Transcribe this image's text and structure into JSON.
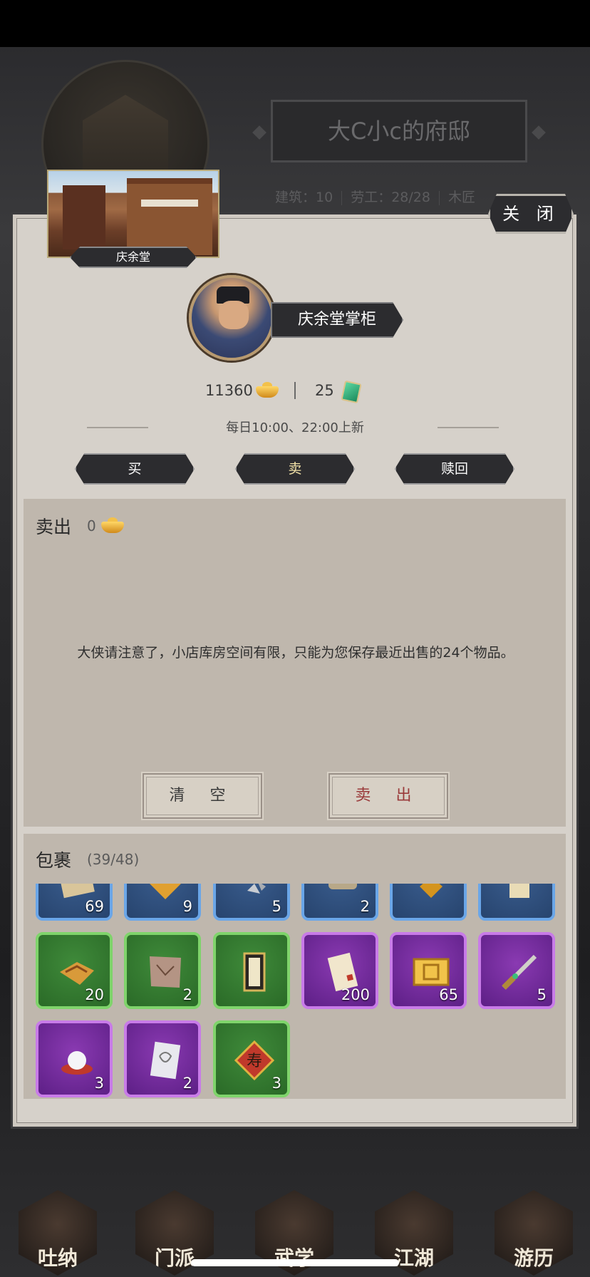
{
  "background": {
    "mansion_title": "大C小c的府邸",
    "stats": [
      "建筑：10",
      "劳工：28/28",
      "木匠"
    ]
  },
  "close_label": "关 闭",
  "shop": {
    "name": "庆余堂"
  },
  "shopkeeper": {
    "name": "庆余堂掌柜"
  },
  "currency": {
    "gold": "11360",
    "jade": "25"
  },
  "refresh_text": "每日10:00、22:00上新",
  "tabs": [
    {
      "label": "买",
      "active": false
    },
    {
      "label": "卖",
      "active": true
    },
    {
      "label": "赎回",
      "active": false
    }
  ],
  "sell": {
    "title": "卖出",
    "total": "0",
    "notice": "大侠请注意了，小店库房空间有限，只能为您保存最近出售的24个物品。",
    "clear_label": "清 空",
    "sell_label": "卖 出"
  },
  "bag": {
    "title": "包裹",
    "count": "(39/48)",
    "items": [
      {
        "icon": "scroll-bundle-icon",
        "rarity": "blue",
        "qty": "69"
      },
      {
        "icon": "gold-ornament-icon",
        "rarity": "blue",
        "qty": "9"
      },
      {
        "icon": "silver-fragments-icon",
        "rarity": "blue",
        "qty": "5"
      },
      {
        "icon": "scroll-roll-icon",
        "rarity": "blue",
        "qty": "2"
      },
      {
        "icon": "gold-pendant-icon",
        "rarity": "blue",
        "qty": ""
      },
      {
        "icon": "document-icon",
        "rarity": "blue",
        "qty": ""
      },
      {
        "icon": "gold-map-icon",
        "rarity": "green",
        "qty": "20"
      },
      {
        "icon": "torn-map-icon",
        "rarity": "green",
        "qty": "2"
      },
      {
        "icon": "martial-scroll-icon",
        "rarity": "green",
        "qty": ""
      },
      {
        "icon": "letter-paper-icon",
        "rarity": "purple",
        "qty": "200"
      },
      {
        "icon": "gold-ticket-icon",
        "rarity": "purple",
        "qty": "65"
      },
      {
        "icon": "dagger-icon",
        "rarity": "purple",
        "qty": "5"
      },
      {
        "icon": "pearl-icon",
        "rarity": "purple",
        "qty": "3"
      },
      {
        "icon": "manual-page-icon",
        "rarity": "purple",
        "qty": "2"
      },
      {
        "icon": "longevity-charm-icon",
        "rarity": "green",
        "qty": "3"
      }
    ]
  },
  "nav": [
    {
      "label": "吐纳"
    },
    {
      "label": "门派"
    },
    {
      "label": "武学"
    },
    {
      "label": "江湖"
    },
    {
      "label": "游历"
    }
  ],
  "colors": {
    "panel": "#d6d1ca",
    "section": "#bfb7ad",
    "button_dark": "#2c2c2f",
    "rarity_blue": "#6aa6e8",
    "rarity_green": "#7fd46b",
    "rarity_purple": "#c87be8",
    "sell_text": "#9a3a3a"
  }
}
